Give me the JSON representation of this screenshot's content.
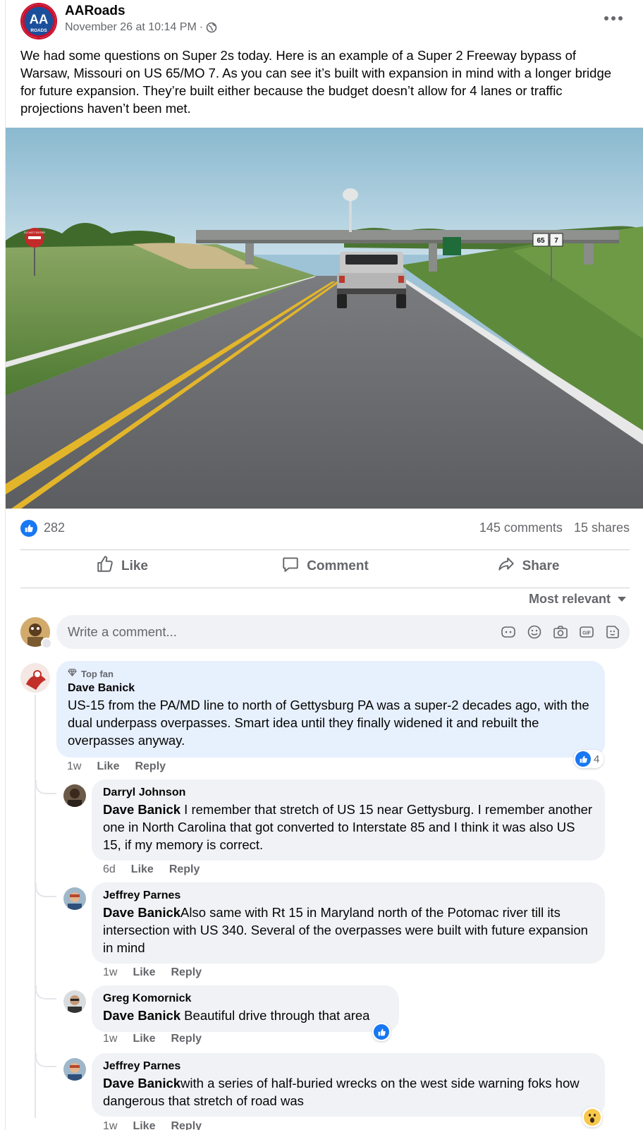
{
  "post": {
    "page_name": "AARoads",
    "timestamp": "November 26 at 10:14 PM",
    "separator": "·",
    "text": "We had some questions on Super 2s today. Here is an example of a Super 2 Freeway bypass of Warsaw, Missouri on US 65/MO 7. As you can see it’s built with expansion in mind with a longer bridge for future expansion. They’re built either because the budget doesn’t allow for 4 lanes or traffic projections haven’t been met.",
    "logo_text": "AA",
    "logo_subtext": "ROADS"
  },
  "stats": {
    "reactions": "282",
    "comments": "145 comments",
    "shares": "15 shares"
  },
  "actions": {
    "like": "Like",
    "comment": "Comment",
    "share": "Share"
  },
  "sort": {
    "label": "Most relevant"
  },
  "composer": {
    "placeholder": "Write a comment..."
  },
  "comments": [
    {
      "badge": "Top fan",
      "author": "Dave Banick",
      "text": "US-15 from the PA/MD line to north of Gettysburg PA was a super-2 decades ago, with the dual underpass overpasses. Smart idea until they finally widened it and rebuilt the overpasses anyway.",
      "age": "1w",
      "like": "Like",
      "reply": "Reply",
      "reaction_count": "4"
    }
  ],
  "replies": [
    {
      "author": "Darryl Johnson",
      "mention": "Dave Banick",
      "text": " I remember that stretch of US 15 near Gettysburg. I remember another one in North Carolina that got converted to Interstate 85 and I think it was also US 15, if my memory is correct.",
      "age": "6d",
      "like": "Like",
      "reply": "Reply"
    },
    {
      "author": "Jeffrey Parnes",
      "mention": "Dave Banick",
      "text": "Also same with Rt 15 in Maryland north of the Potomac river till its intersection with US 340. Several of the overpasses were built with future expansion in mind",
      "age": "1w",
      "like": "Like",
      "reply": "Reply"
    },
    {
      "author": "Greg Komornick",
      "mention": "Dave Banick",
      "text": " Beautiful drive through that area",
      "age": "1w",
      "like": "Like",
      "reply": "Reply"
    },
    {
      "author": "Jeffrey Parnes",
      "mention": "Dave Banick",
      "text": "with a series of half-buried wrecks on the west side warning foks how dangerous that stretch of road was",
      "age": "1w",
      "like": "Like",
      "reply": "Reply"
    }
  ],
  "photo": {
    "stop_sign_text": "DO NOT ENTER",
    "route_shield_1": "65",
    "route_shield_2": "7"
  },
  "colors": {
    "facebook_blue": "#1877f2",
    "secondary_text": "#65676b",
    "bubble_gray": "#f0f2f5",
    "top_fan_bubble": "#e7f0fd",
    "logo_red": "#c8102e",
    "logo_blue": "#1b4f9c"
  },
  "icons": [
    "globe-icon",
    "more-icon",
    "like-icon",
    "comment-icon",
    "share-icon",
    "caret-down-icon",
    "sticker-icon",
    "emoji-icon",
    "camera-icon",
    "gif-icon",
    "avatar-sticker-icon",
    "diamond-icon",
    "wow-icon"
  ]
}
